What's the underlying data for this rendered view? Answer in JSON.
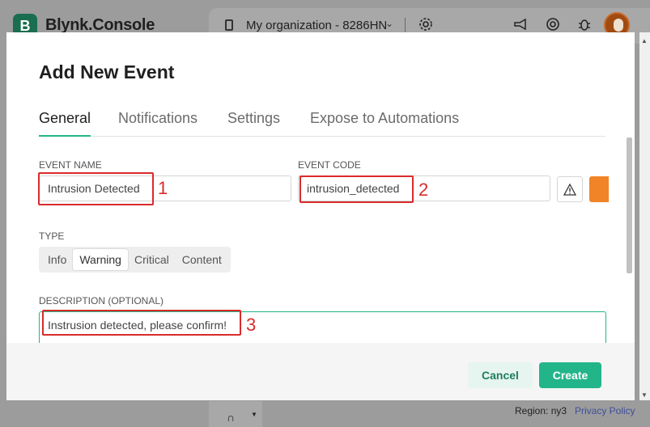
{
  "background": {
    "logo_letter": "B",
    "brand": "Blynk.Console",
    "organization": "My organization - 8286HN",
    "region": "Region: ny3",
    "privacy_link": "Privacy Policy"
  },
  "modal": {
    "title": "Add New Event",
    "tabs": [
      {
        "label": "General",
        "active": true
      },
      {
        "label": "Notifications",
        "active": false
      },
      {
        "label": "Settings",
        "active": false
      },
      {
        "label": "Expose to Automations",
        "active": false
      }
    ],
    "event_name": {
      "label": "EVENT NAME",
      "value": "Intrusion Detected"
    },
    "event_code": {
      "label": "EVENT CODE",
      "value": "intrusion_detected"
    },
    "type": {
      "label": "TYPE",
      "options": [
        "Info",
        "Warning",
        "Critical",
        "Content"
      ],
      "selected": "Warning"
    },
    "description": {
      "label": "DESCRIPTION (OPTIONAL)",
      "value": "Instrusion detected, please confirm!"
    },
    "buttons": {
      "cancel": "Cancel",
      "create": "Create"
    },
    "event_color": "#f08426"
  },
  "annotations": [
    "1",
    "2",
    "3"
  ],
  "colors": {
    "accent": "#23b58a",
    "annotation": "#d92b2b"
  }
}
